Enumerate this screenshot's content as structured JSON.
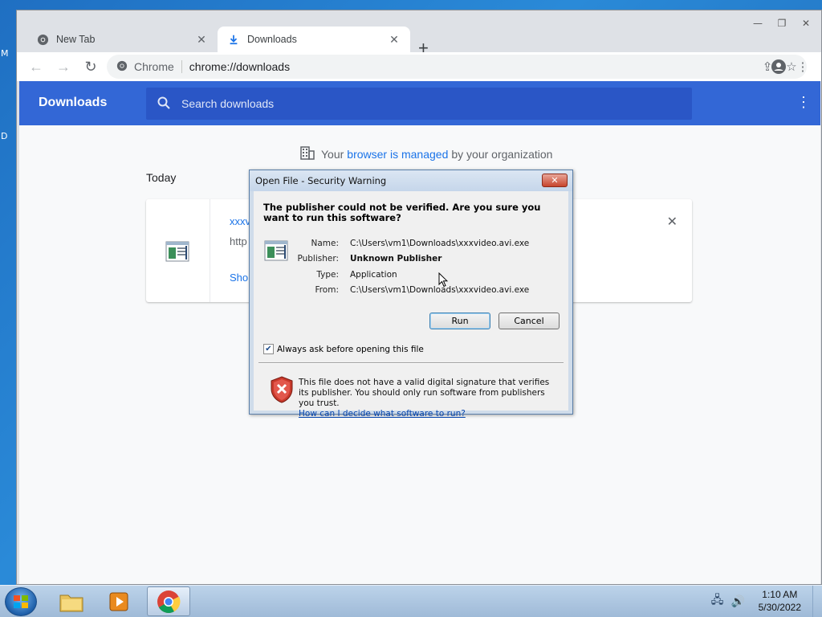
{
  "desktop": {
    "edge_letters": [
      "M",
      "D"
    ]
  },
  "browser": {
    "window_controls": [
      "minimize",
      "restore",
      "close"
    ],
    "tabs": [
      {
        "title": "New Tab",
        "icon": "chrome-icon"
      },
      {
        "title": "Downloads",
        "icon": "download-icon"
      }
    ],
    "omnibox": {
      "site_chip": "Chrome",
      "url": "chrome://downloads"
    }
  },
  "downloads_page": {
    "title": "Downloads",
    "search_placeholder": "Search downloads",
    "managed_notice": {
      "prefix": "Your",
      "link": "browser is managed",
      "suffix": "by your organization"
    },
    "section_label": "Today",
    "item": {
      "name_partial": "xxxv",
      "url_partial": "http",
      "action_partial": "Sho"
    }
  },
  "dialog": {
    "title": "Open File - Security Warning",
    "heading": "The publisher could not be verified.  Are you sure you want to run this software?",
    "fields": [
      {
        "key": "Name:",
        "value": "C:\\Users\\vm1\\Downloads\\xxxvideo.avi.exe",
        "bold": false
      },
      {
        "key": "Publisher:",
        "value": "Unknown Publisher",
        "bold": true
      },
      {
        "key": "Type:",
        "value": "Application",
        "bold": false
      },
      {
        "key": "From:",
        "value": "C:\\Users\\vm1\\Downloads\\xxxvideo.avi.exe",
        "bold": false
      }
    ],
    "run_label": "Run",
    "cancel_label": "Cancel",
    "checkbox_label": "Always ask before opening this file",
    "checkbox_checked": true,
    "warning_text": "This file does not have a valid digital signature that verifies its publisher.  You should only run software from publishers you trust.",
    "help_link": "How can I decide what software to run?"
  },
  "taskbar": {
    "apps": [
      "file-explorer",
      "media-player",
      "chrome"
    ],
    "clock_time": "1:10 AM",
    "clock_date": "5/30/2022"
  },
  "colors": {
    "downloads_header": "#3367d6",
    "link": "#1a73e8",
    "dialog_frame": "#cfdcea"
  }
}
